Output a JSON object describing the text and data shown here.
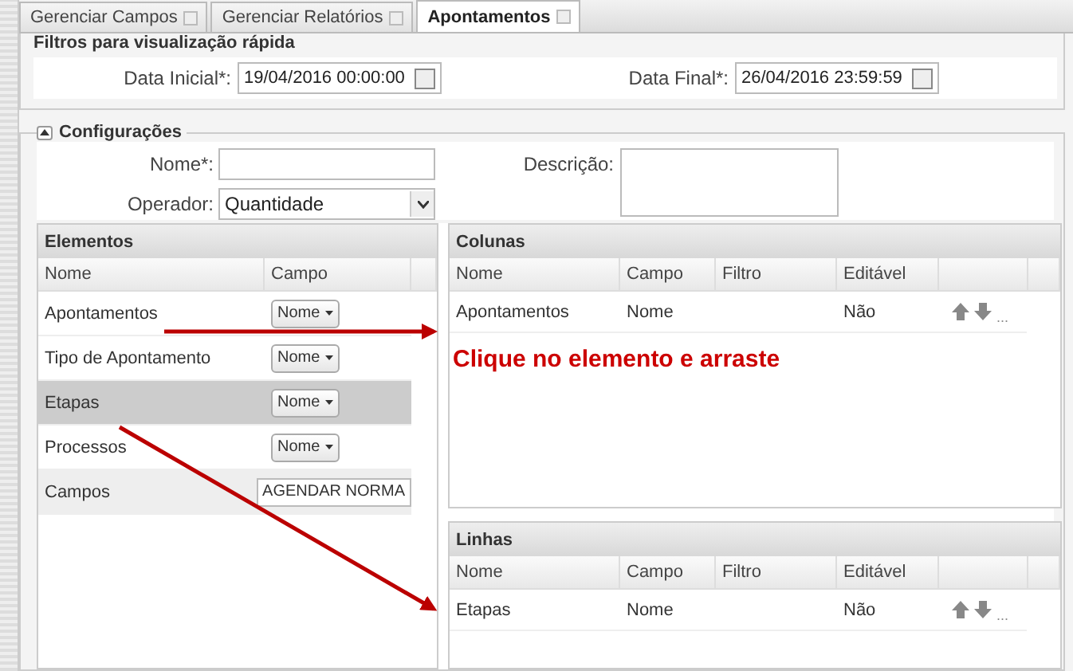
{
  "tabs": [
    {
      "label": "Gerenciar Campos",
      "selected": false
    },
    {
      "label": "Gerenciar Relatórios",
      "selected": false
    },
    {
      "label": "Apontamentos",
      "selected": true
    }
  ],
  "filters": {
    "legend": "Filtros para visualização rápida",
    "fields": [
      {
        "label": "Data Inicial*:",
        "value": "19/04/2016 00:00:00"
      },
      {
        "label": "Data Final*:",
        "value": "26/04/2016 23:59:59"
      }
    ]
  },
  "config": {
    "legend": "Configurações",
    "expanded": true,
    "name_label": "Nome*:",
    "operator_label": "Operador:",
    "operator_value": "Quantidade",
    "description_label": "Descrição:"
  },
  "elements": {
    "title": "Elementos",
    "columns": [
      "Nome",
      "Campo"
    ],
    "rows": [
      {
        "name": "Apontamentos",
        "field": "Nome",
        "kind": "dropdown",
        "selected": false
      },
      {
        "name": "Tipo de Apontamento",
        "field": "Nome",
        "kind": "dropdown",
        "selected": false
      },
      {
        "name": "Etapas",
        "field": "Nome",
        "kind": "dropdown",
        "selected": true
      },
      {
        "name": "Processos",
        "field": "Nome",
        "kind": "dropdown",
        "selected": false
      },
      {
        "name": "Campos",
        "field": "AGENDAR NORMA",
        "kind": "text",
        "selected": false
      }
    ]
  },
  "columns_panel": {
    "title": "Colunas",
    "columns": [
      "Nome",
      "Campo",
      "Filtro",
      "Editável"
    ],
    "rows": [
      {
        "nome": "Apontamentos",
        "campo": "Nome",
        "editavel": "Não",
        "more": "..."
      }
    ]
  },
  "hint": "Clique no elemento e arraste",
  "lines_panel": {
    "title": "Linhas",
    "columns": [
      "Nome",
      "Campo",
      "Filtro",
      "Editável"
    ],
    "rows": [
      {
        "nome": "Etapas",
        "campo": "Nome",
        "editavel": "Não",
        "more": "..."
      }
    ]
  }
}
